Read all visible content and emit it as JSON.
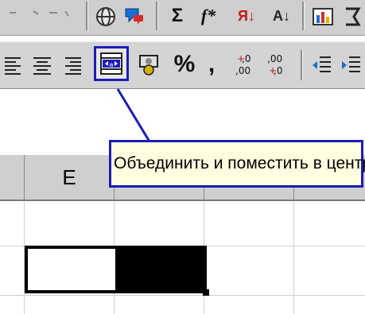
{
  "toolbar_top": {
    "items": [
      "web-toolbar-icon",
      "paste-function-icon",
      "sigma-icon",
      "function-icon",
      "sort-ascending-icon",
      "sort-descending-icon",
      "chart-wizard-icon"
    ],
    "sigma": "Σ",
    "fx": "f*",
    "sort_asc": "Я↓",
    "sort_desc": "А↓"
  },
  "toolbar_format": {
    "align_left": "align-left-icon",
    "align_center": "align-center-icon",
    "align_right": "align-right-icon",
    "merge_center": "merge-and-center-icon",
    "currency": "currency-icon",
    "percent": "%",
    "comma": ",",
    "inc_decimal": "+,0\n,00",
    "dec_decimal": ",00\n+,0",
    "decrease_indent": "decrease-indent-icon",
    "increase_indent": "increase-indent-icon"
  },
  "tooltip": {
    "text": "Объединить и поместить в центре"
  },
  "sheet": {
    "column_headers": [
      "E",
      "",
      "",
      ""
    ],
    "colors": {
      "highlight_border": "#1c1cb8",
      "tooltip_bg": "#ffffe1",
      "selection_fill": "#000000"
    }
  }
}
